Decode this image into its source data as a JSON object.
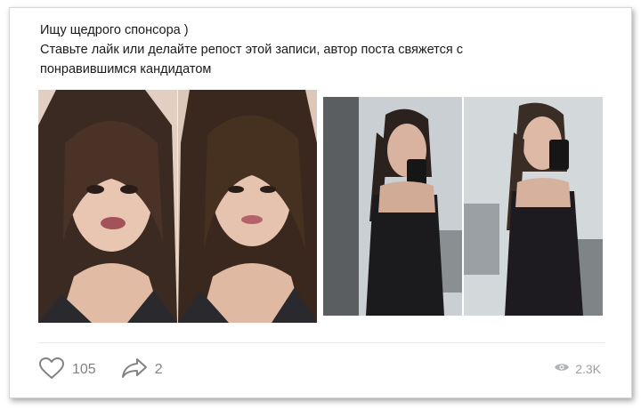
{
  "post": {
    "line1": "Ищу щедрого спонсора )",
    "line2": "Ставьте лайк или делайте репост этой записи, автор поста свяжется с",
    "line3": "понравившимся кандидатом"
  },
  "actions": {
    "like_count": "105",
    "share_count": "2",
    "views_count": "2.3K"
  },
  "icons": {
    "like": "heart-icon",
    "share": "share-arrow-icon",
    "views": "eye-icon"
  },
  "colors": {
    "text": "#1a1a1a",
    "muted": "#828282",
    "border": "#d3d6da"
  }
}
